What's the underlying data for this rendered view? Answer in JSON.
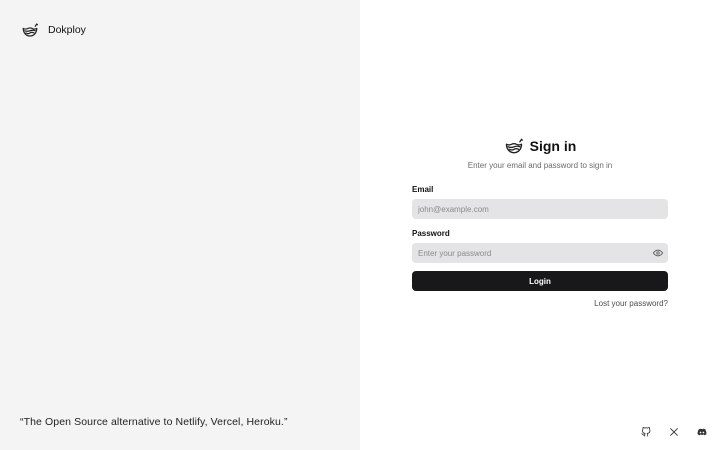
{
  "brand": {
    "name": "Dokploy",
    "logo_icon": "dokploy-whale-icon"
  },
  "quote": "“The Open Source alternative to Netlify, Vercel, Heroku.”",
  "signin": {
    "title": "Sign in",
    "subtitle": "Enter your email and password to sign in",
    "email_label": "Email",
    "email_placeholder": "john@example.com",
    "email_value": "",
    "password_label": "Password",
    "password_placeholder": "Enter your password",
    "password_value": "",
    "password_toggle_icon": "eye-icon",
    "login_label": "Login",
    "lost_password_label": "Lost your password?"
  },
  "socials": [
    {
      "icon": "github-icon"
    },
    {
      "icon": "x-icon"
    },
    {
      "icon": "discord-icon"
    }
  ],
  "colors": {
    "left_panel_bg": "#f4f4f4",
    "input_bg": "#e4e4e7",
    "button_bg": "#18181b",
    "button_text": "#ffffff",
    "muted_text": "#6b6b6b"
  }
}
